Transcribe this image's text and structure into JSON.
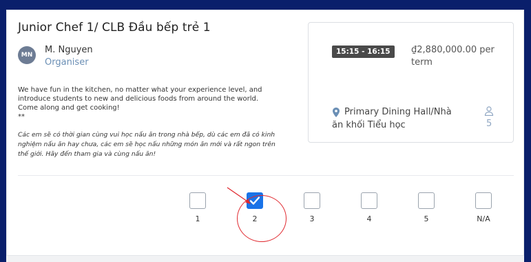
{
  "activity": {
    "title": "Junior Chef 1/ CLB Đầu bếp trẻ 1",
    "organiser": {
      "initials": "MN",
      "name": "M. Nguyen",
      "role": "Organiser"
    },
    "description_en_lines": [
      "We have fun in the kitchen, no matter what your experience level, and",
      "introduce students to new and delicious foods from around the world.",
      "Come along and get cooking!",
      "**"
    ],
    "description_vi_lines": [
      "Các em sẽ có thời gian cùng vui học nấu ăn trong nhà bếp, dù các em đã có kinh",
      "nghiệm nấu ăn hay chưa, các em sẽ học nấu những món ăn mới và rất ngon trên",
      "thế giới. Hãy đến tham gia và cùng nấu ăn!"
    ]
  },
  "info": {
    "time": "15:15 - 16:15",
    "price": "₫2,880,000.00 per term",
    "location": "Primary Dining Hall/Nhà ăn khối Tiểu học",
    "capacity": "5"
  },
  "choices": [
    {
      "label": "1",
      "checked": false
    },
    {
      "label": "2",
      "checked": true
    },
    {
      "label": "3",
      "checked": false
    },
    {
      "label": "4",
      "checked": false
    },
    {
      "label": "5",
      "checked": false
    },
    {
      "label": "N/A",
      "checked": false
    }
  ],
  "colors": {
    "background": "#0a1f6b",
    "checked": "#1a73e8",
    "annotation": "#e0282e",
    "organiser_role": "#6b8fb5"
  }
}
